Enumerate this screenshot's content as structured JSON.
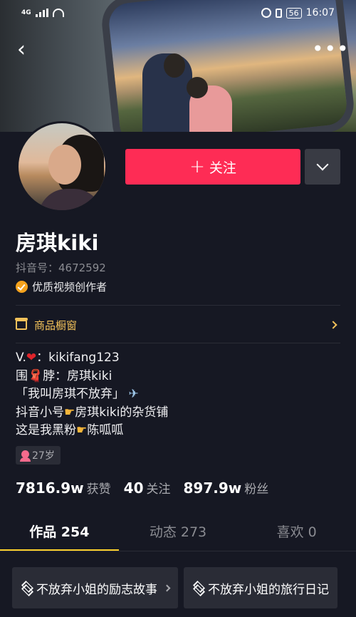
{
  "status_bar": {
    "network": "4G",
    "battery": "56",
    "time": "16:07"
  },
  "header": {
    "back_icon": "chevron-left-icon",
    "more_icon": "more-horizontal-icon"
  },
  "profile": {
    "name": "房琪kiki",
    "douyin_id": "抖音号：4672592",
    "badge": "优质视频创作者",
    "follow_label": "关注",
    "shop_label": "商品橱窗"
  },
  "bio": {
    "line1_a": "V.",
    "line1_b": "：kikifang123",
    "line2_a": "围",
    "line2_b": "脖：房琪kiki",
    "line3_a": "「我叫房琪不放弃」",
    "line4_a": "抖音小号",
    "line4_b": "房琪kiki的杂货铺",
    "line5_a": "这是我黑粉",
    "line5_b": "陈呱呱"
  },
  "age_tag": "27岁",
  "stats": [
    {
      "num": "7816.9w",
      "label": "获赞"
    },
    {
      "num": "40",
      "label": "关注"
    },
    {
      "num": "897.9w",
      "label": "粉丝"
    }
  ],
  "tabs": [
    {
      "label": "作品 254"
    },
    {
      "label": "动态 273"
    },
    {
      "label": "喜欢 0"
    }
  ],
  "collections": [
    {
      "label": "不放弃小姐的励志故事"
    },
    {
      "label": "不放弃小姐的旅行日记"
    }
  ],
  "colors": {
    "background": "#161823",
    "follow_button": "#fe2c55",
    "accent_yellow": "#facf2c",
    "shop_gold": "#f3c25a"
  }
}
